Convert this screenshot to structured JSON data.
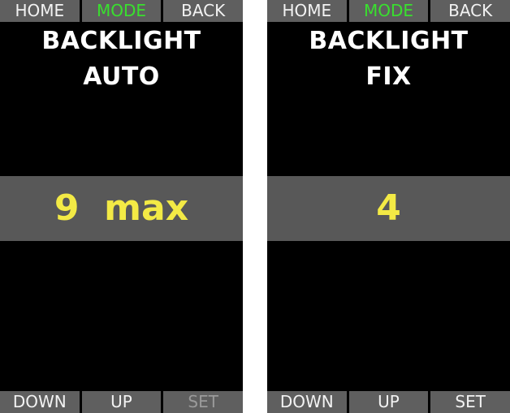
{
  "colors": {
    "screen_background": "#000000",
    "softkey_background": "#5f5f5f",
    "softkey_text": "#f2f2f2",
    "softkey_active_text": "#39e02e",
    "softkey_disabled_text": "#9a9a9a",
    "title_text": "#ffffff",
    "value_band": "#585858",
    "value_text": "#f3ea45"
  },
  "screens": [
    {
      "top_keys": [
        "HOME",
        "MODE",
        "BACK"
      ],
      "active_top_key": "MODE",
      "title": "BACKLIGHT",
      "mode": "AUTO",
      "value": "9  max",
      "bottom_keys": [
        "DOWN",
        "UP",
        "SET"
      ],
      "disabled_bottom_key": "SET"
    },
    {
      "top_keys": [
        "HOME",
        "MODE",
        "BACK"
      ],
      "active_top_key": "MODE",
      "title": "BACKLIGHT",
      "mode": "FIX",
      "value": "4",
      "bottom_keys": [
        "DOWN",
        "UP",
        "SET"
      ],
      "disabled_bottom_key": ""
    }
  ]
}
